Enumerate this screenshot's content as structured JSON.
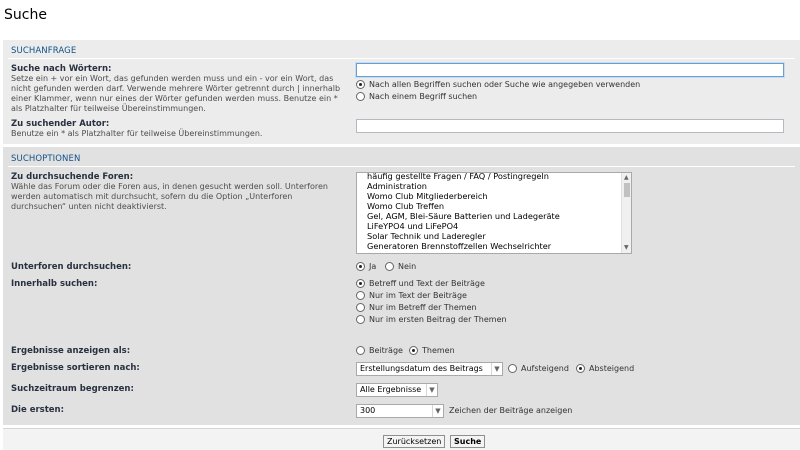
{
  "page": {
    "title": "Suche"
  },
  "query": {
    "header": "SUCHANFRAGE",
    "words_label": "Suche nach Wörtern:",
    "words_desc": "Setze ein + vor ein Wort, das gefunden werden muss und ein - vor ein Wort, das nicht gefunden werden darf. Verwende mehrere Wörter getrennt durch | innerhalb einer Klammer, wenn nur eines der Wörter gefunden werden muss. Benutze ein * als Platzhalter für teilweise Übereinstimmungen.",
    "words_value": "",
    "mode_all": "Nach allen Begriffen suchen oder Suche wie angegeben verwenden",
    "mode_any": "Nach einem Begriff suchen",
    "author_label": "Zu suchender Autor:",
    "author_desc": "Benutze ein * als Platzhalter für teilweise Übereinstimmungen.",
    "author_value": ""
  },
  "options": {
    "header": "SUCHOPTIONEN",
    "forums_label": "Zu durchsuchende Foren:",
    "forums_desc": "Wähle das Forum oder die Foren aus, in denen gesucht werden soll. Unterforen werden automatisch mit durchsucht, sofern du die Option „Unterforen durchsuchen“ unten nicht deaktivierst.",
    "forums": [
      "häufig gestellte Fragen / FAQ / Postingregeln",
      "Administration",
      "Womo Club Mitgliederbereich",
      "Womo Club Treffen",
      "Gel, AGM, Blei-Säure Batterien und Ladegeräte",
      "LiFeYPO4 und LiFePO4",
      "Solar Technik und Laderegler",
      "Generatoren Brennstoffzellen Wechselrichter"
    ],
    "subforums_label": "Unterforen durchsuchen:",
    "subforums_yes": "Ja",
    "subforums_no": "Nein",
    "within_label": "Innerhalb suchen:",
    "within_1": "Betreff und Text der Beiträge",
    "within_2": "Nur im Text der Beiträge",
    "within_3": "Nur im Betreff der Themen",
    "within_4": "Nur im ersten Beitrag der Themen",
    "display_label": "Ergebnisse anzeigen als:",
    "display_posts": "Beiträge",
    "display_topics": "Themen",
    "sort_label": "Ergebnisse sortieren nach:",
    "sort_value": "Erstellungsdatum des Beitrags",
    "sort_asc": "Aufsteigend",
    "sort_desc": "Absteigend",
    "time_label": "Suchzeitraum begrenzen:",
    "time_value": "Alle Ergebnisse",
    "first_label": "Die ersten:",
    "first_value": "300",
    "first_suffix": "Zeichen der Beiträge anzeigen"
  },
  "footer": {
    "reset_label": "Zurücksetzen",
    "search_label": "Suche"
  },
  "icons": {
    "chevron": "chevron-down-icon",
    "scroll_up": "chevron-up-icon",
    "scroll_down": "chevron-down-icon"
  },
  "colors": {
    "section_header": "#105289",
    "panel_light": "#ececec",
    "panel_dark": "#e1e1e1"
  }
}
